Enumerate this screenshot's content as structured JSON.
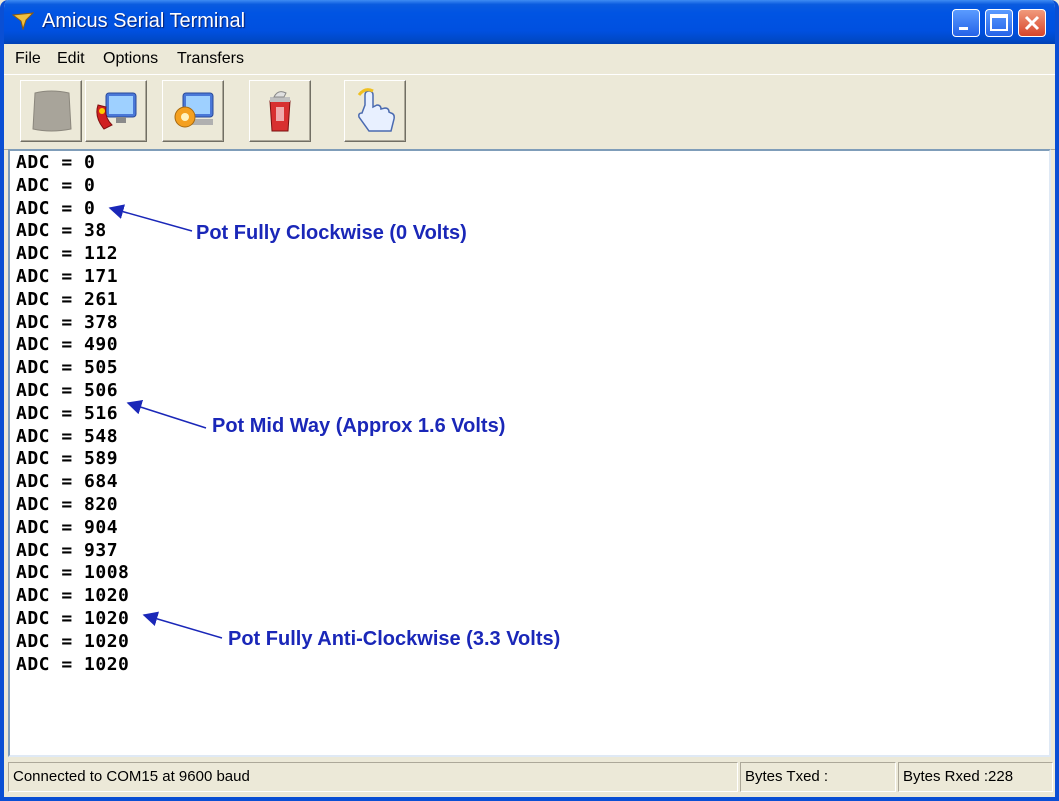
{
  "window": {
    "title": "Amicus Serial Terminal"
  },
  "menu": [
    "File",
    "Edit",
    "Options",
    "Transfers"
  ],
  "toolbar_buttons": [
    {
      "icon": "disconnect-icon"
    },
    {
      "icon": "connect-icon"
    },
    {
      "icon": "settings-icon"
    },
    {
      "icon": "clear-icon"
    },
    {
      "icon": "hand-icon"
    }
  ],
  "terminal": {
    "lines": [
      "ADC = 0",
      "ADC = 0",
      "ADC = 0",
      "ADC = 38",
      "ADC = 112",
      "ADC = 171",
      "ADC = 261",
      "ADC = 378",
      "ADC = 490",
      "ADC = 505",
      "ADC = 506",
      "ADC = 516",
      "ADC = 548",
      "ADC = 589",
      "ADC = 684",
      "ADC = 820",
      "ADC = 904",
      "ADC = 937",
      "ADC = 1008",
      "ADC = 1020",
      "ADC = 1020",
      "ADC = 1020",
      "ADC = 1020"
    ],
    "annotations": [
      "Pot Fully Clockwise (0 Volts)",
      "Pot Mid Way (Approx 1.6 Volts)",
      "Pot Fully Anti-Clockwise (3.3 Volts)"
    ],
    "annotation_color": "#1a27b8"
  },
  "status": {
    "connection": "Connected to COM15 at 9600 baud",
    "bytes_txed": "Bytes Txed :",
    "bytes_rxed": "Bytes Rxed :228"
  }
}
